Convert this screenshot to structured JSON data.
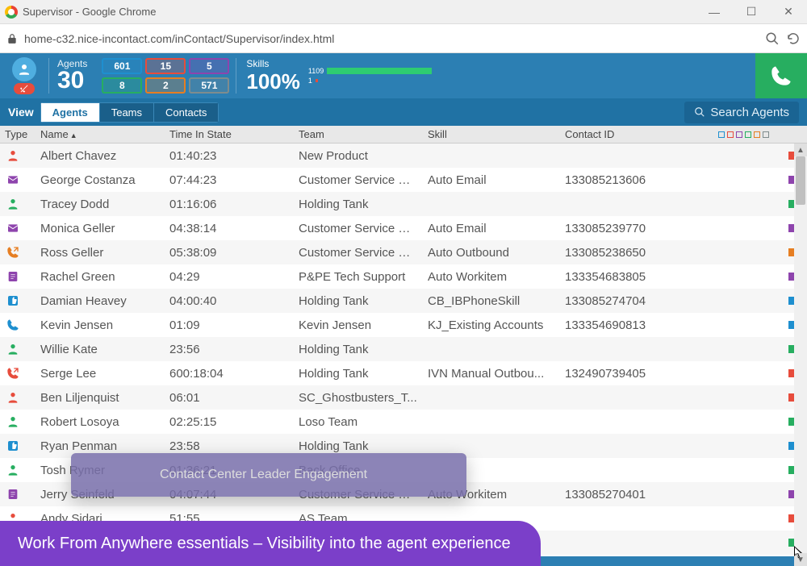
{
  "window": {
    "title": "Supervisor - Google Chrome",
    "url": "home-c32.nice-incontact.com/inContact/Supervisor/index.html"
  },
  "header": {
    "agents_label": "Agents",
    "agents_count": "30",
    "pills": [
      {
        "value": "601",
        "color": "#1e8fcf"
      },
      {
        "value": "15",
        "color": "#e74c3c"
      },
      {
        "value": "5",
        "color": "#8e44ad"
      },
      {
        "value": "8",
        "color": "#27ae60"
      },
      {
        "value": "2",
        "color": "#e67e22"
      },
      {
        "value": "571",
        "color": "#7f8c8d"
      }
    ],
    "skills_label": "Skills",
    "skills_value": "100%",
    "skills_top_num": "1109",
    "skills_bot_num": "1"
  },
  "viewbar": {
    "label": "View",
    "tabs": [
      "Agents",
      "Teams",
      "Contacts"
    ],
    "active_tab": 0,
    "search_placeholder": "Search Agents"
  },
  "columns": {
    "type": "Type",
    "name": "Name",
    "time": "Time In State",
    "team": "Team",
    "skill": "Skill",
    "contact": "Contact ID"
  },
  "legend_colors": [
    "#1e8fcf",
    "#e74c3c",
    "#8e44ad",
    "#27ae60",
    "#e67e22",
    "#7f8c8d"
  ],
  "rows": [
    {
      "icon": "person",
      "icon_color": "#e74c3c",
      "name": "Albert Chavez",
      "time": "01:40:23",
      "team": "New Product",
      "skill": "",
      "contact": "",
      "ind": "#e74c3c"
    },
    {
      "icon": "mail",
      "icon_color": "#8e44ad",
      "name": "George Costanza",
      "time": "07:44:23",
      "team": "Customer Service M...",
      "skill": "Auto Email",
      "contact": "133085213606",
      "ind": "#8e44ad"
    },
    {
      "icon": "person",
      "icon_color": "#27ae60",
      "name": "Tracey Dodd",
      "time": "01:16:06",
      "team": "Holding Tank",
      "skill": "",
      "contact": "",
      "ind": "#27ae60"
    },
    {
      "icon": "mail",
      "icon_color": "#8e44ad",
      "name": "Monica Geller",
      "time": "04:38:14",
      "team": "Customer Service M...",
      "skill": "Auto Email",
      "contact": "133085239770",
      "ind": "#8e44ad"
    },
    {
      "icon": "phone-out",
      "icon_color": "#e67e22",
      "name": "Ross Geller",
      "time": "05:38:09",
      "team": "Customer Service M...",
      "skill": "Auto Outbound",
      "contact": "133085238650",
      "ind": "#e67e22"
    },
    {
      "icon": "doc",
      "icon_color": "#8e44ad",
      "name": "Rachel Green",
      "time": "04:29",
      "team": "P&PE Tech Support",
      "skill": "Auto Workitem",
      "contact": "133354683805",
      "ind": "#8e44ad"
    },
    {
      "icon": "thumb",
      "icon_color": "#1e8fcf",
      "name": "Damian Heavey",
      "time": "04:00:40",
      "team": "Holding Tank",
      "skill": "CB_IBPhoneSkill",
      "contact": "133085274704",
      "ind": "#1e8fcf"
    },
    {
      "icon": "phone",
      "icon_color": "#1e8fcf",
      "name": "Kevin Jensen",
      "time": "01:09",
      "team": "Kevin Jensen",
      "skill": "KJ_Existing Accounts",
      "contact": "133354690813",
      "ind": "#1e8fcf"
    },
    {
      "icon": "person",
      "icon_color": "#27ae60",
      "name": "Willie Kate",
      "time": "23:56",
      "team": "Holding Tank",
      "skill": "",
      "contact": "",
      "ind": "#27ae60"
    },
    {
      "icon": "phone-out",
      "icon_color": "#e74c3c",
      "name": "Serge Lee",
      "time": "600:18:04",
      "team": "Holding Tank",
      "skill": "IVN Manual Outbou...",
      "contact": "132490739405",
      "ind": "#e74c3c"
    },
    {
      "icon": "person",
      "icon_color": "#e74c3c",
      "name": "Ben Liljenquist",
      "time": "06:01",
      "team": "SC_Ghostbusters_T...",
      "skill": "",
      "contact": "",
      "ind": "#e74c3c"
    },
    {
      "icon": "person",
      "icon_color": "#27ae60",
      "name": "Robert Losoya",
      "time": "02:25:15",
      "team": "Loso Team",
      "skill": "",
      "contact": "",
      "ind": "#27ae60"
    },
    {
      "icon": "thumb",
      "icon_color": "#1e8fcf",
      "name": "Ryan Penman",
      "time": "23:58",
      "team": "Holding Tank",
      "skill": "",
      "contact": "",
      "ind": "#1e8fcf"
    },
    {
      "icon": "person",
      "icon_color": "#27ae60",
      "name": "Tosh Rymer",
      "time": "01:36:21",
      "team": "Back Office",
      "skill": "",
      "contact": "",
      "ind": "#27ae60"
    },
    {
      "icon": "doc",
      "icon_color": "#8e44ad",
      "name": "Jerry Seinfeld",
      "time": "04:07:44",
      "team": "Customer Service M...",
      "skill": "Auto Workitem",
      "contact": "133085270401",
      "ind": "#8e44ad"
    },
    {
      "icon": "person",
      "icon_color": "#e74c3c",
      "name": "Andy Sidari",
      "time": "51:55",
      "team": "AS Team",
      "skill": "",
      "contact": "",
      "ind": "#e74c3c"
    },
    {
      "icon": "",
      "icon_color": "",
      "name": "",
      "time": "",
      "team": "",
      "skill": "",
      "contact": "",
      "ind": "#27ae60"
    }
  ],
  "tooltip_text": "Contact Center Leader Engagement",
  "banner_text": "Work From Anywhere essentials – Visibility into the agent experience"
}
